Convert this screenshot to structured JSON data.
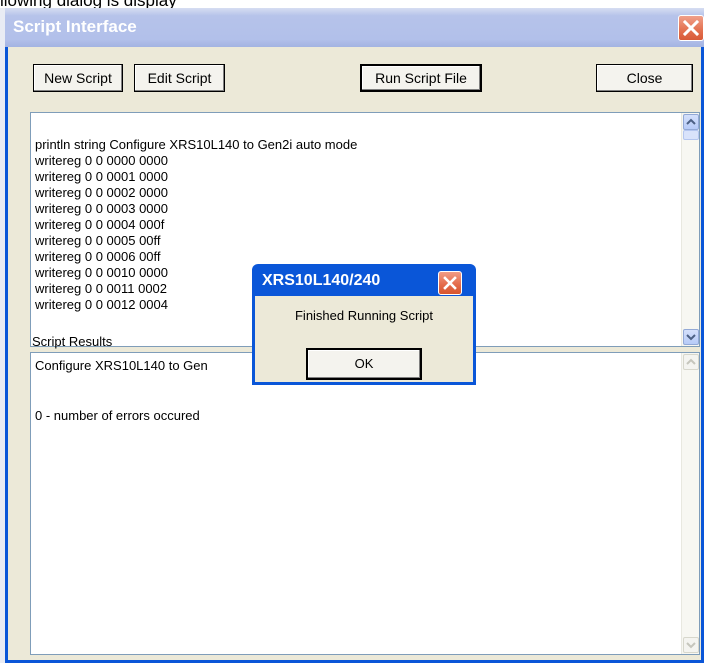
{
  "background_text": "llowing dialog is display",
  "window": {
    "title": "Script Interface",
    "buttons": {
      "new_script": "New Script",
      "edit_script": "Edit Script",
      "run_script_file": "Run Script File",
      "close": "Close"
    },
    "script_lines": [
      "println  string Configure XRS10L140 to Gen2i auto mode",
      "writereg  0 0 0000 0000",
      "writereg  0 0 0001 0000",
      "writereg  0 0 0002 0000",
      "writereg  0 0 0003 0000",
      "writereg  0 0 0004 000f",
      "writereg  0 0 0005 00ff",
      "writereg  0 0 0006 00ff",
      "writereg  0 0 0010 0000",
      "writereg  0 0 0011 0002",
      "writereg  0 0 0012 0004"
    ],
    "results_label": "Script Results",
    "results_lines": [
      "Configure XRS10L140 to Gen",
      "",
      "",
      "0 - number of errors occured"
    ]
  },
  "dialog": {
    "title": "XRS10L140/240",
    "message": "Finished Running Script",
    "ok_label": "OK"
  },
  "colors": {
    "title_bar": "#0a56d8",
    "face": "#ece9d8",
    "close_button": "#e3704f"
  }
}
